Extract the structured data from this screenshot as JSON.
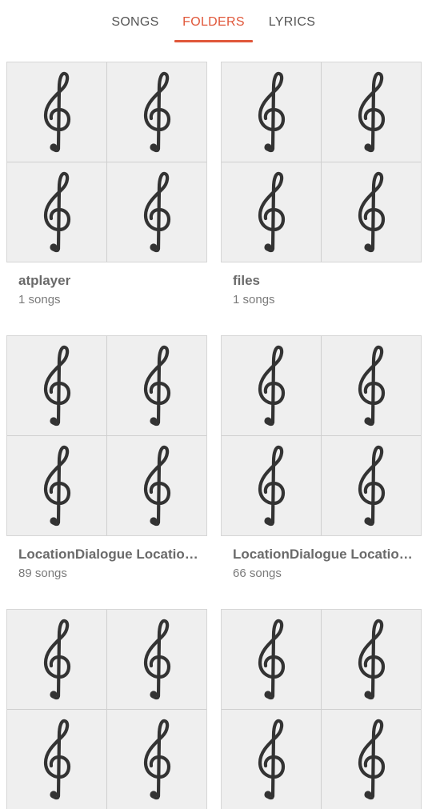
{
  "tabs": {
    "songs": "SONGS",
    "folders": "FOLDERS",
    "lyrics": "LYRICS",
    "active": "folders",
    "accent_color": "#e0573a"
  },
  "folders": [
    {
      "name": "atplayer",
      "count": "1 songs",
      "art_icon": "treble-clef-icon"
    },
    {
      "name": "files",
      "count": "1 songs",
      "art_icon": "treble-clef-icon"
    },
    {
      "name": "LocationDialogue LocationDialogue",
      "count": "89 songs",
      "art_icon": "treble-clef-icon"
    },
    {
      "name": "LocationDialogue LocationDialogue",
      "count": "66 songs",
      "art_icon": "treble-clef-icon"
    },
    {
      "name": "",
      "count": "",
      "art_icon": "treble-clef-icon"
    },
    {
      "name": "",
      "count": "",
      "art_icon": "treble-clef-icon"
    }
  ]
}
